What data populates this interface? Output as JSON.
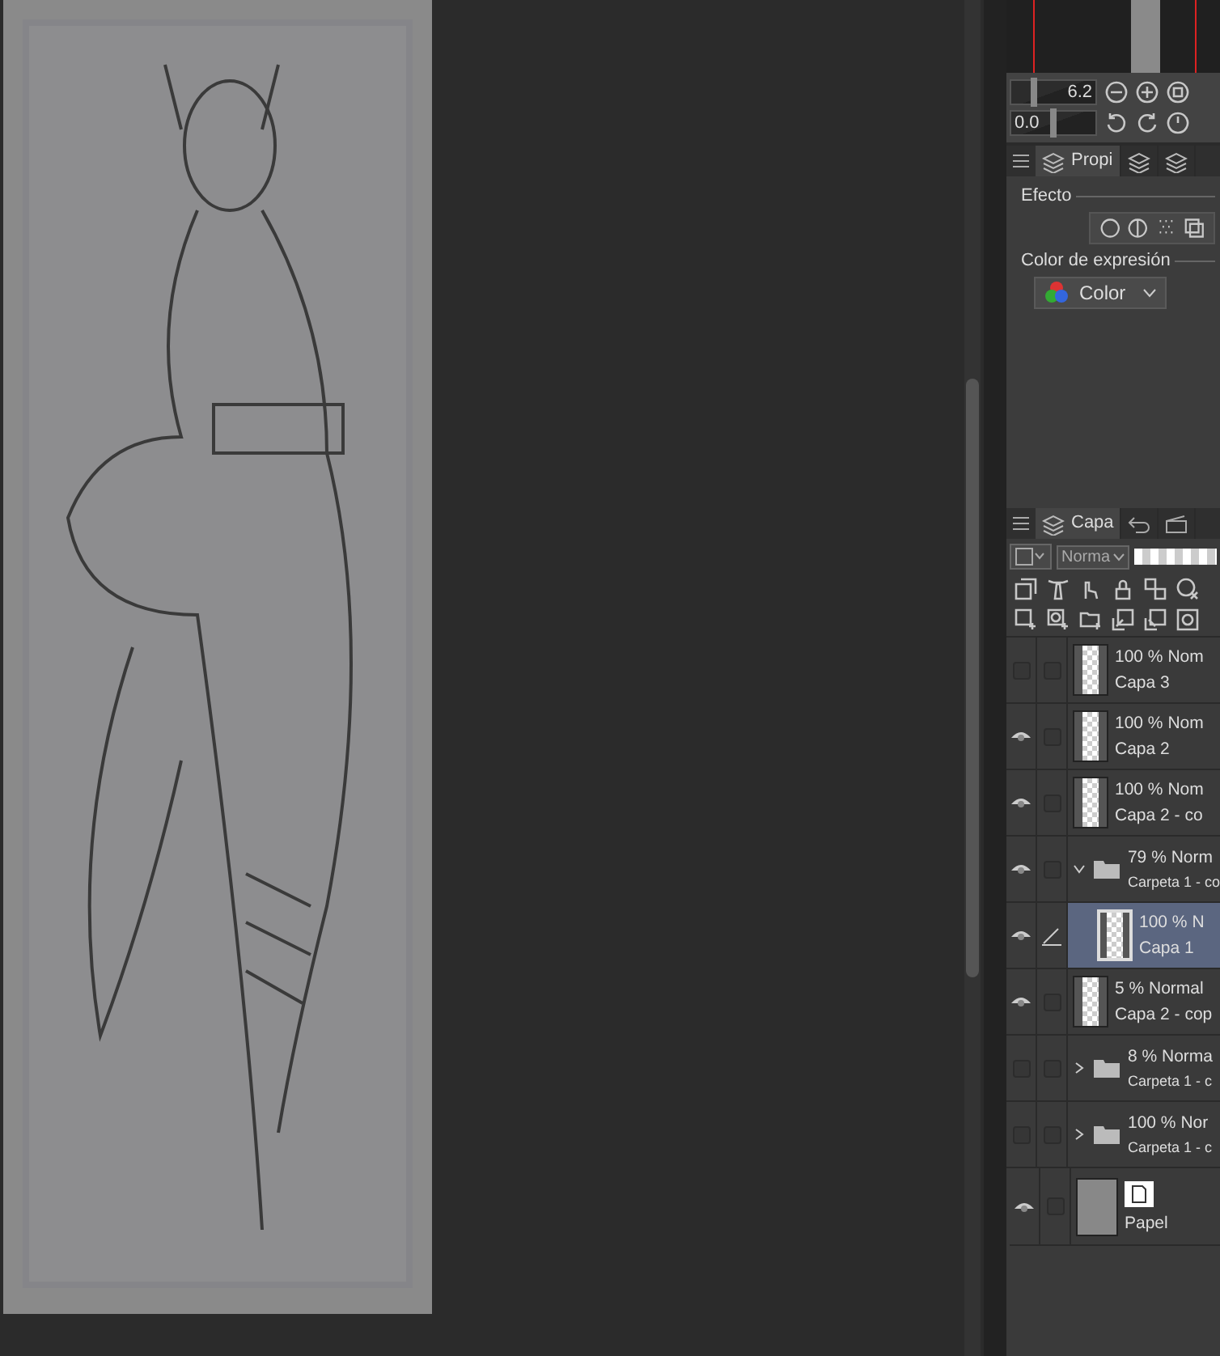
{
  "navigator": {
    "zoom": "6.2",
    "zoom_level": {
      "level": 0.25
    },
    "rotation": "0.0",
    "rotation_level": {
      "level": 0.5
    }
  },
  "properties_panel": {
    "tabs": [
      {
        "label": "Propi",
        "selected": true
      },
      {
        "selected": false
      },
      {
        "selected": false
      }
    ],
    "effect_label": "Efecto",
    "expression_label": "Color de expresión",
    "expression_value": "Color"
  },
  "layer_panel": {
    "tab": {
      "label": "Capa",
      "selected": true
    },
    "blend_mode": "Norma",
    "opacity": {
      "level": 1
    },
    "layers": [
      {
        "kind": "layer",
        "visible": false,
        "selected": false,
        "editing": false,
        "mode": "100 % Nom",
        "name": "Capa 3"
      },
      {
        "kind": "layer",
        "visible": true,
        "selected": false,
        "editing": false,
        "mode": "100 % Nom",
        "name": "Capa 2"
      },
      {
        "kind": "layer",
        "visible": true,
        "selected": false,
        "editing": false,
        "mode": "100 % Nom",
        "name": "Capa 2 - co"
      },
      {
        "kind": "folder",
        "visible": true,
        "selected": false,
        "editing": false,
        "expanded": true,
        "mode": "79 % Norm",
        "name": "Carpeta 1 - co",
        "children": [
          {
            "kind": "layer",
            "visible": true,
            "selected": true,
            "editing": true,
            "mode": "100 % N",
            "name": "Capa 1"
          }
        ]
      },
      {
        "kind": "layer",
        "visible": true,
        "selected": false,
        "editing": false,
        "mode": "5 % Normal",
        "name": "Capa 2 - cop"
      },
      {
        "kind": "folder",
        "visible": false,
        "selected": false,
        "editing": false,
        "expanded": false,
        "mode": "8 % Norma",
        "name": "Carpeta 1 - c"
      },
      {
        "kind": "folder",
        "visible": false,
        "selected": false,
        "editing": false,
        "expanded": false,
        "mode": "100 % Nor",
        "name": "Carpeta 1 - c"
      },
      {
        "kind": "paper",
        "visible": true,
        "selected": false,
        "editing": false,
        "name": "Papel"
      }
    ]
  }
}
